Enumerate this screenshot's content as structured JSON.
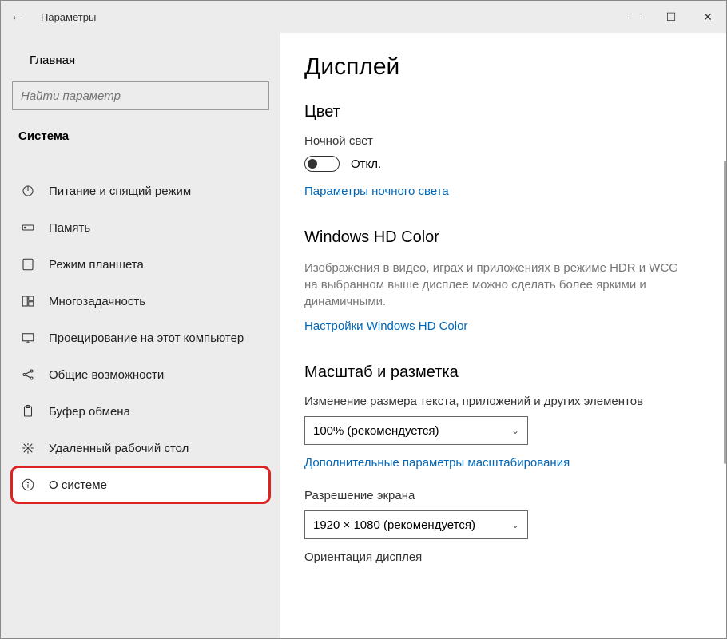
{
  "titlebar": {
    "back": "←",
    "title": "Параметры",
    "minimize": "—",
    "maximize": "☐",
    "close": "✕"
  },
  "sidebar": {
    "home": "Главная",
    "search_placeholder": "Найти параметр",
    "category": "Система",
    "items": [
      {
        "id": "power",
        "label": "Питание и спящий режим"
      },
      {
        "id": "storage",
        "label": "Память"
      },
      {
        "id": "tablet",
        "label": "Режим планшета"
      },
      {
        "id": "multitask",
        "label": "Многозадачность"
      },
      {
        "id": "projecting",
        "label": "Проецирование на этот компьютер"
      },
      {
        "id": "shared",
        "label": "Общие возможности"
      },
      {
        "id": "clipboard",
        "label": "Буфер обмена"
      },
      {
        "id": "remote",
        "label": "Удаленный рабочий стол"
      },
      {
        "id": "about",
        "label": "О системе"
      }
    ]
  },
  "main": {
    "heading": "Дисплей",
    "sections": {
      "color": {
        "title": "Цвет",
        "night_label": "Ночной свет",
        "toggle_text": "Откл.",
        "night_link": "Параметры ночного света"
      },
      "hd": {
        "title": "Windows HD Color",
        "desc": "Изображения в видео, играх и приложениях в режиме HDR и WCG на выбранном выше дисплее можно сделать более яркими и динамичными.",
        "link": "Настройки Windows HD Color"
      },
      "scale": {
        "title": "Масштаб и разметка",
        "scale_label": "Изменение размера текста, приложений и других элементов",
        "scale_value": "100% (рекомендуется)",
        "advanced_link": "Дополнительные параметры масштабирования",
        "res_label": "Разрешение экрана",
        "res_value": "1920 × 1080 (рекомендуется)",
        "orient_label": "Ориентация дисплея"
      }
    }
  }
}
